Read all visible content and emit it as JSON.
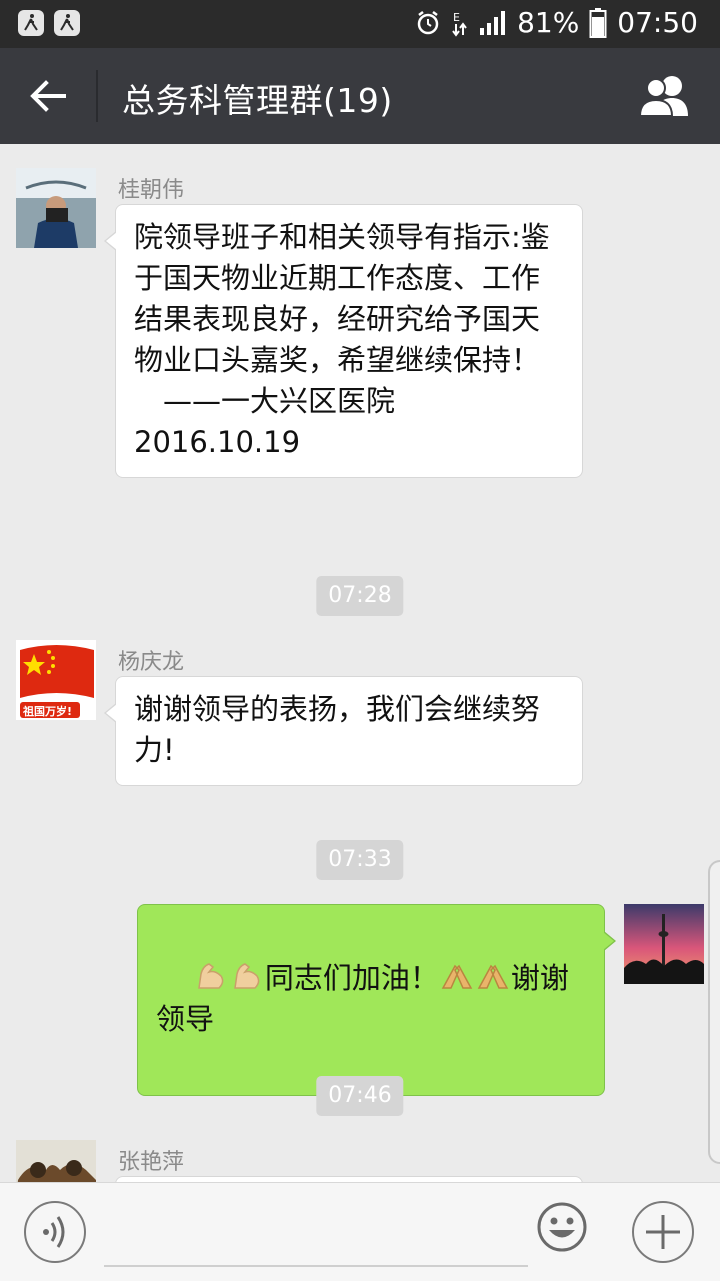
{
  "status_bar": {
    "battery_percent": "81%",
    "time": "07:50",
    "icons": [
      "walk-icon",
      "walk-icon",
      "alarm-icon",
      "data-icon",
      "signal-icon",
      "battery-icon"
    ]
  },
  "header": {
    "title": "总务科管理群(19)",
    "back_icon": "arrow-left-icon",
    "group_icon": "group-members-icon"
  },
  "messages": [
    {
      "sender": "桂朝伟",
      "side": "left",
      "text": "院领导班子和相关领导有指示:鉴于国天物业近期工作态度、工作结果表现良好，经研究给予国天物业口头嘉奖，希望继续保持！\n　——一大兴区医院\n2016.10.19"
    },
    {
      "time": "07:28"
    },
    {
      "sender": "杨庆龙",
      "side": "left",
      "text": "谢谢领导的表扬，我们会继续努力!",
      "avatar_caption": "祖国万岁!"
    },
    {
      "time": "07:33"
    },
    {
      "side": "right",
      "text_part1": "同志们加油！",
      "text_part2": "谢谢领导",
      "emojis": [
        "flexed-biceps-icon",
        "flexed-biceps-icon",
        "folded-hands-icon",
        "folded-hands-icon"
      ]
    },
    {
      "time": "07:46"
    },
    {
      "sender": "张艳萍",
      "side": "left"
    }
  ],
  "input_bar": {
    "placeholder": "",
    "voice_icon": "voice-icon",
    "emoji_icon": "smiley-icon",
    "plus_icon": "plus-icon"
  },
  "colors": {
    "status_bar": "#2b2b2b",
    "app_bar": "#393a3f",
    "chat_background": "#ebebeb",
    "own_bubble": "#a0e759",
    "other_bubble": "#ffffff",
    "time_pill": "#d5d5d5"
  }
}
